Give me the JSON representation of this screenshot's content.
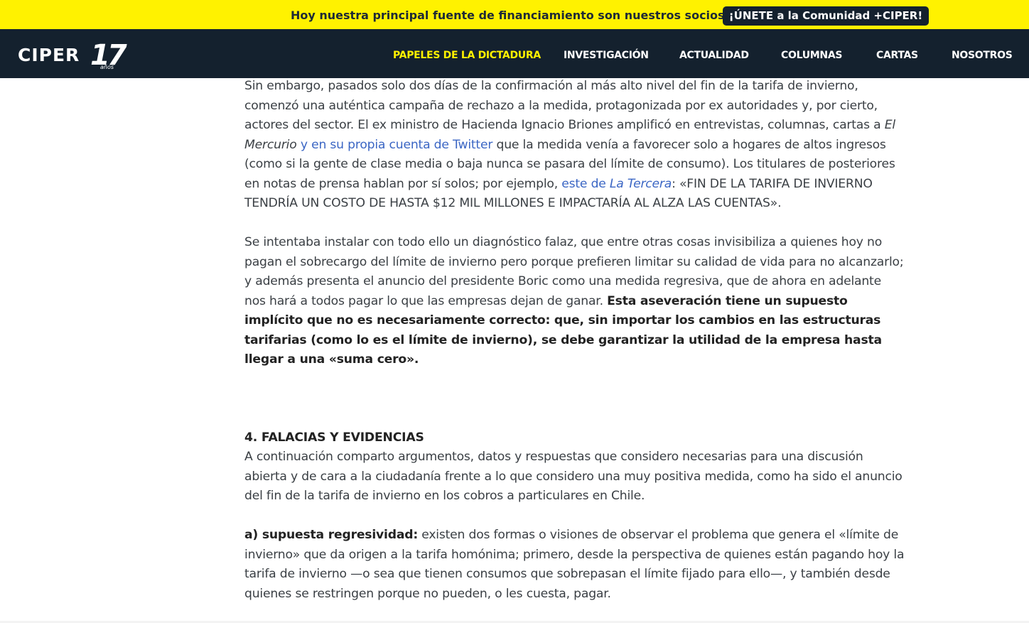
{
  "promo": {
    "text": "Hoy nuestra principal fuente de financiamiento son nuestros socios.",
    "button": "¡ÚNETE a la Comunidad +CIPER!"
  },
  "logo": {
    "name": "CIPER",
    "number": "17",
    "sub": "años"
  },
  "nav": {
    "items": [
      {
        "label": "PAPELES DE LA DICTADURA",
        "active": true
      },
      {
        "label": "INVESTIGACIÓN"
      },
      {
        "label": "ACTUALIDAD"
      },
      {
        "label": "COLUMNAS"
      },
      {
        "label": "CARTAS"
      },
      {
        "label": "NOSOTROS"
      }
    ]
  },
  "colors": {
    "promo_bg": "#fff200",
    "nav_bg": "#14212e",
    "link": "#3b66c4",
    "active_nav": "#fff200"
  },
  "article": {
    "p1": {
      "t1": "Sin embargo, pasados solo dos días de la confirmación al más alto nivel del fin de la tarifa de invierno, comenzó una auténtica campaña de rechazo a la medida, protagonizada por ex autoridades y, por cierto, actores del sector. El ex ministro de Hacienda Ignacio Briones amplificó en entrevistas, columnas, cartas a ",
      "em1": "El Mercurio",
      "link1": " y en su propia cuenta de Twitter",
      "t2": " que la medida venía a favorecer solo a hogares de altos ingresos (como si la gente de clase media o baja nunca se pasara del límite de consumo). Los titulares de posteriores en notas de prensa hablan por sí solos; por ejemplo, ",
      "link2a": "este de ",
      "link2b": "La Tercera",
      "t3": ": «FIN DE LA TARIFA DE INVIERNO TENDRÍA UN COSTO DE HASTA $12 MIL MILLONES E IMPACTARÍA AL ALZA LAS CUENTAS»."
    },
    "p2": {
      "t1": "Se intentaba instalar con todo ello un diagnóstico falaz, que entre otras cosas invisibiliza a quienes hoy no pagan el sobrecargo del límite de invierno pero porque prefieren limitar su calidad de vida para no alcanzarlo; y además presenta el anuncio del presidente Boric como una medida regresiva, que de ahora en adelante nos hará a todos pagar lo que las empresas dejan de ganar. ",
      "bold": "Esta aseveración tiene un supuesto implícito que no es necesariamente correcto: que, sin importar los cambios en las estructuras tarifarias (como lo es el límite de invierno), se debe garantizar la utilidad de la empresa hasta llegar a una «suma cero»."
    },
    "section_heading": "4. FALACIAS Y EVIDENCIAS",
    "p3": "A continuación comparto argumentos, datos y respuestas que considero necesarias para una discusión abierta y de cara a la ciudadanía frente a lo que considero una muy positiva medida, como ha sido el anuncio del fin de la tarifa de invierno en los cobros a particulares en Chile.",
    "p4": {
      "bold": "a) supuesta regresividad:",
      "t1": " existen dos formas o visiones de observar el problema que genera el «límite de invierno» que da origen a la tarifa homónima; primero, desde la perspectiva de quienes están pagando hoy la tarifa de invierno —o sea que tienen consumos que sobrepasan el límite fijado para ello—, y también desde quienes se restringen porque no pueden, o les cuesta, pagar."
    }
  }
}
